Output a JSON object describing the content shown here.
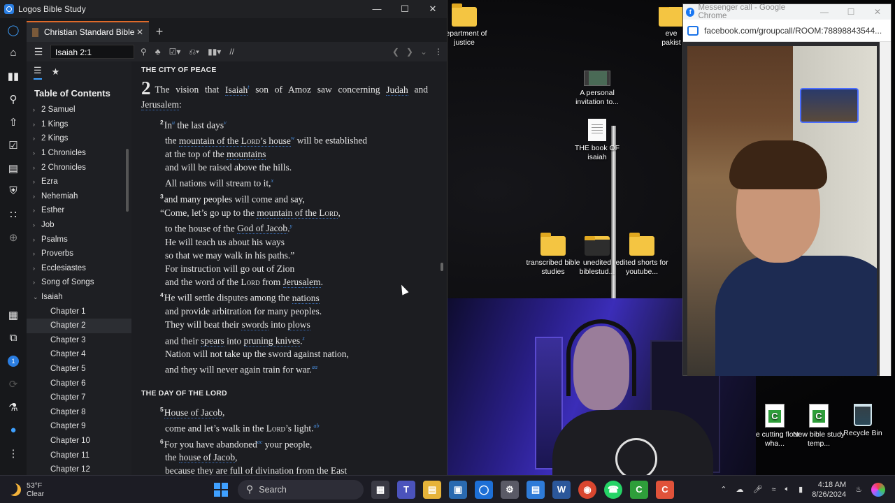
{
  "logos": {
    "window_title": "Logos Bible Study",
    "tab_title": "Christian Standard Bible",
    "reference": "Isaiah 2:1",
    "toc_title": "Table of Contents",
    "toc_books": [
      "2 Samuel",
      "1 Kings",
      "2 Kings",
      "1 Chronicles",
      "2 Chronicles",
      "Ezra",
      "Nehemiah",
      "Esther",
      "Job",
      "Psalms",
      "Proverbs",
      "Ecclesiastes",
      "Song of Songs",
      "Isaiah"
    ],
    "toc_chapters": [
      "Chapter 1",
      "Chapter 2",
      "Chapter 3",
      "Chapter 4",
      "Chapter 5",
      "Chapter 6",
      "Chapter 7",
      "Chapter 8",
      "Chapter 9",
      "Chapter 10",
      "Chapter 11",
      "Chapter 12"
    ],
    "selected_chapter": "Chapter 2",
    "badge_count": "1",
    "section1": "THE CITY OF PEACE",
    "chapter_number": "2",
    "section2": "THE DAY OF THE LORD"
  },
  "desktop": {
    "icons": {
      "doj": "department of justice",
      "invite": "A personal invitation to...",
      "isaiah_doc": "THE book OF isaiah",
      "transcribed": "transcribed bible studies",
      "unedited": "unedited biblestud...",
      "shorts": "edited shorts for youtube...",
      "cutting": "the cutting floor wha...",
      "template": "New bible study temp...",
      "recycle": "Recycle Bin",
      "partial_top": "eve pakist"
    }
  },
  "chrome": {
    "title": "Messenger call - Google Chrome",
    "url": "facebook.com/groupcall/ROOM:78898843544..."
  },
  "taskbar": {
    "temp": "53°F",
    "condition": "Clear",
    "search_placeholder": "Search",
    "time": "4:18 AM",
    "date": "8/26/2024"
  },
  "colors": {
    "accent": "#3ea0ff",
    "tab_accent": "#e06a2a",
    "footnote": "#4a8fe0"
  }
}
